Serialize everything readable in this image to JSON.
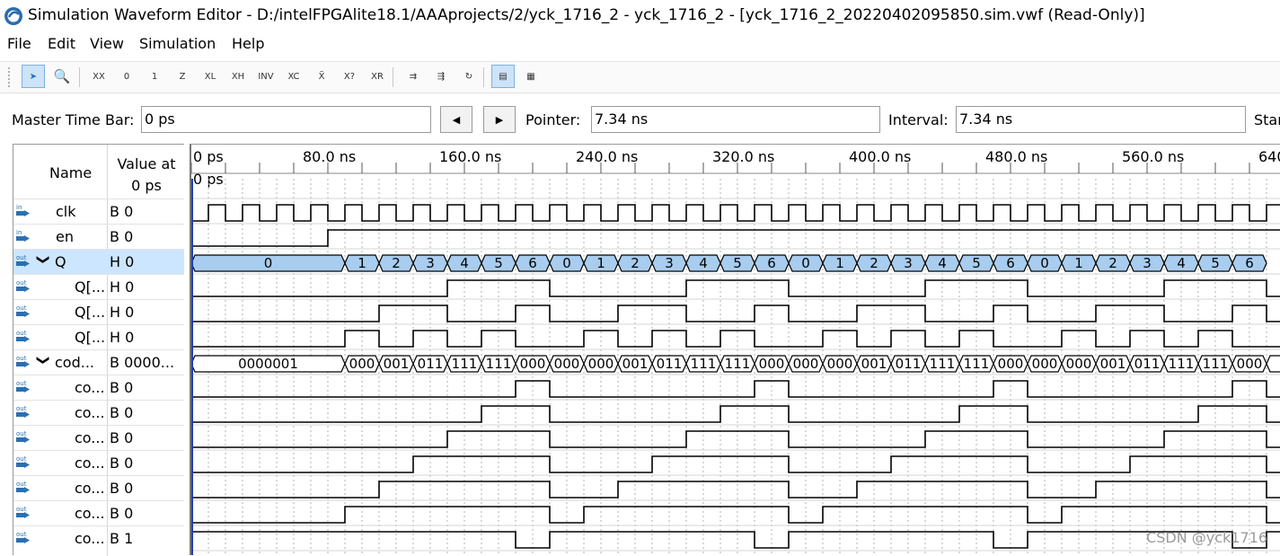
{
  "window": {
    "title": "Simulation Waveform Editor - D:/intelFPGAlite18.1/AAAprojects/2/yck_1716_2 - yck_1716_2 - [yck_1716_2_20220402095850.sim.vwf (Read-Only)]"
  },
  "menu": [
    "File",
    "Edit",
    "View",
    "Simulation",
    "Help"
  ],
  "toolbar": {
    "buttons": [
      {
        "name": "selection-tool-icon",
        "glyph": "➤",
        "active": true
      },
      {
        "name": "zoom-tool-icon",
        "glyph": "🔍",
        "active": false
      },
      {
        "name": "forcing-unknown-icon",
        "glyph": "XX",
        "active": false
      },
      {
        "name": "forcing-low-icon",
        "glyph": "0",
        "active": false
      },
      {
        "name": "forcing-high-icon",
        "glyph": "1",
        "active": false
      },
      {
        "name": "high-impedance-icon",
        "glyph": "Z",
        "active": false
      },
      {
        "name": "weak-low-icon",
        "glyph": "XL",
        "active": false
      },
      {
        "name": "weak-high-icon",
        "glyph": "XH",
        "active": false
      },
      {
        "name": "invert-icon",
        "glyph": "INV",
        "active": false
      },
      {
        "name": "count-value-icon",
        "glyph": "XC",
        "active": false
      },
      {
        "name": "overwrite-clock-icon",
        "glyph": "X̃",
        "active": false
      },
      {
        "name": "random-values-icon",
        "glyph": "X?",
        "active": false
      },
      {
        "name": "arbitrary-value-icon",
        "glyph": "XR",
        "active": false
      },
      {
        "name": "run-functional-simulation-icon",
        "glyph": "⇉",
        "active": false
      },
      {
        "name": "run-timing-simulation-icon",
        "glyph": "⇶",
        "active": false
      },
      {
        "name": "generate-netlist-icon",
        "glyph": "↻",
        "active": false
      },
      {
        "name": "snap-to-grid-icon",
        "glyph": "▤",
        "active": true
      },
      {
        "name": "grid-settings-icon",
        "glyph": "▦",
        "active": false
      }
    ]
  },
  "timebar": {
    "master_label": "Master Time Bar:",
    "master_value": "0 ps",
    "prev_glyph": "◀",
    "next_glyph": "▶",
    "pointer_label": "Pointer:",
    "pointer_value": "7.34 ns",
    "interval_label": "Interval:",
    "interval_value": "7.34 ns",
    "start_label": "Star"
  },
  "signal_panel": {
    "col_name": "Name",
    "col_value_line1": "Value at",
    "col_value_line2": "0 ps",
    "rows": [
      {
        "dir": "in",
        "name": "clk",
        "value": "B 0",
        "indent": 0
      },
      {
        "dir": "in",
        "name": "en",
        "value": "B 0",
        "indent": 0
      },
      {
        "dir": "out",
        "name": "Q",
        "value": "H 0",
        "indent": 0,
        "expand": "❯",
        "selected": true
      },
      {
        "dir": "out",
        "name": "Q[...",
        "value": "H 0",
        "indent": 1
      },
      {
        "dir": "out",
        "name": "Q[...",
        "value": "H 0",
        "indent": 1
      },
      {
        "dir": "out",
        "name": "Q[...",
        "value": "H 0",
        "indent": 1
      },
      {
        "dir": "out",
        "name": "cod...",
        "value": "B 0000...",
        "indent": 0,
        "expand": "❯"
      },
      {
        "dir": "out",
        "name": "co...",
        "value": "B 0",
        "indent": 1
      },
      {
        "dir": "out",
        "name": "co...",
        "value": "B 0",
        "indent": 1
      },
      {
        "dir": "out",
        "name": "co...",
        "value": "B 0",
        "indent": 1
      },
      {
        "dir": "out",
        "name": "co...",
        "value": "B 0",
        "indent": 1
      },
      {
        "dir": "out",
        "name": "co...",
        "value": "B 0",
        "indent": 1
      },
      {
        "dir": "out",
        "name": "co...",
        "value": "B 0",
        "indent": 1
      },
      {
        "dir": "out",
        "name": "co...",
        "value": "B 1",
        "indent": 1
      }
    ]
  },
  "timeline": {
    "ticks": [
      "0 ps",
      "80.0 ns",
      "160.0 ns",
      "240.0 ns",
      "320.0 ns",
      "400.0 ns",
      "480.0 ns",
      "560.0 ns",
      "640"
    ],
    "cursor_label": "0 ps"
  },
  "waveform": {
    "clock_period_ns": 20,
    "en_rises_ns": 80,
    "q_bus_first": "0",
    "q_sequence": [
      "1",
      "2",
      "3",
      "4",
      "5",
      "6",
      "0",
      "1",
      "2",
      "3",
      "4",
      "5",
      "6",
      "0",
      "1",
      "2",
      "3",
      "4",
      "5",
      "6",
      "0",
      "1",
      "2",
      "3",
      "4",
      "5",
      "6"
    ],
    "code_bus_first": "0000001",
    "code_sequence": [
      "000",
      "001",
      "011",
      "111",
      "111",
      "000",
      "000",
      "000",
      "001",
      "011",
      "111",
      "111",
      "000",
      "000",
      "000",
      "001",
      "011",
      "111",
      "111",
      "000",
      "000",
      "000",
      "001",
      "011",
      "111",
      "111",
      "000",
      "0"
    ]
  },
  "watermark": "CSDN @yck1716",
  "colors": {
    "selected_row": "#cce6ff",
    "bus_fill": "#a8cdee",
    "wave_line": "#000000",
    "in_icon": "#2a6fb5",
    "out_icon": "#2a6fb5"
  }
}
